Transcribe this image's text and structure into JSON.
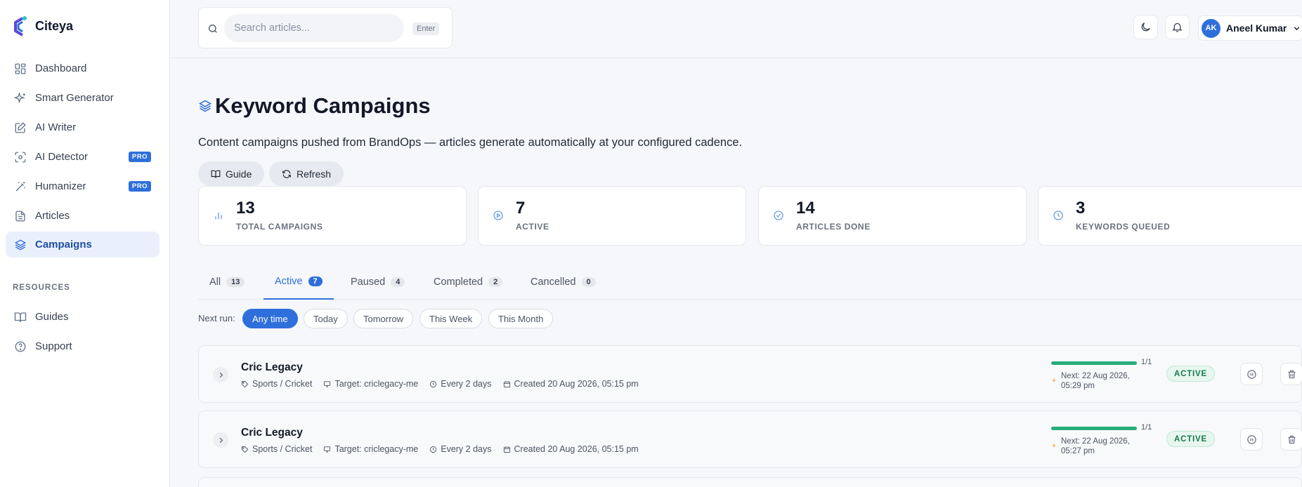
{
  "brand": {
    "name": "Citeya"
  },
  "sidebar": {
    "items": [
      {
        "label": "Dashboard"
      },
      {
        "label": "Smart Generator"
      },
      {
        "label": "AI Writer"
      },
      {
        "label": "AI Detector",
        "badge": "PRO"
      },
      {
        "label": "Humanizer",
        "badge": "PRO"
      },
      {
        "label": "Articles"
      },
      {
        "label": "Campaigns",
        "active": true
      }
    ],
    "resources_label": "RESOURCES",
    "resources": [
      {
        "label": "Guides"
      },
      {
        "label": "Support"
      }
    ]
  },
  "search": {
    "placeholder": "Search articles...",
    "shortcut": "Enter"
  },
  "user": {
    "initials": "AK",
    "name": "Aneel Kumar"
  },
  "page": {
    "title": "Keyword Campaigns",
    "subtitle": "Content campaigns pushed from BrandOps — articles generate automatically at your configured cadence.",
    "guide_label": "Guide",
    "refresh_label": "Refresh"
  },
  "stats": [
    {
      "value": "13",
      "label": "TOTAL CAMPAIGNS"
    },
    {
      "value": "7",
      "label": "ACTIVE"
    },
    {
      "value": "14",
      "label": "ARTICLES DONE"
    },
    {
      "value": "3",
      "label": "KEYWORDS QUEUED"
    }
  ],
  "tabs": [
    {
      "label": "All",
      "count": "13"
    },
    {
      "label": "Active",
      "count": "7",
      "active": true
    },
    {
      "label": "Paused",
      "count": "4"
    },
    {
      "label": "Completed",
      "count": "2"
    },
    {
      "label": "Cancelled",
      "count": "0"
    }
  ],
  "filters": {
    "label": "Next run:",
    "options": [
      "Any time",
      "Today",
      "Tomorrow",
      "This Week",
      "This Month"
    ],
    "selected": "Any time"
  },
  "campaigns": [
    {
      "title": "Cric Legacy",
      "category": "Sports / Cricket",
      "target": "Target: criclegacy-me",
      "cadence": "Every 2 days",
      "created": "Created 20 Aug 2026, 05:15 pm",
      "progress_text": "1/1",
      "progress": 1.0,
      "next_run": "Next: 22 Aug 2026, 05:29 pm",
      "status": "ACTIVE"
    },
    {
      "title": "Cric Legacy",
      "category": "Sports / Cricket",
      "target": "Target: criclegacy-me",
      "cadence": "Every 2 days",
      "created": "Created 20 Aug 2026, 05:15 pm",
      "progress_text": "1/1",
      "progress": 1.0,
      "next_run": "Next: 22 Aug 2026, 05:27 pm",
      "status": "ACTIVE"
    }
  ],
  "colors": {
    "accent": "#2f6fdc",
    "success": "#27ad79",
    "sidebar_active_bg": "#eaf0fb"
  }
}
